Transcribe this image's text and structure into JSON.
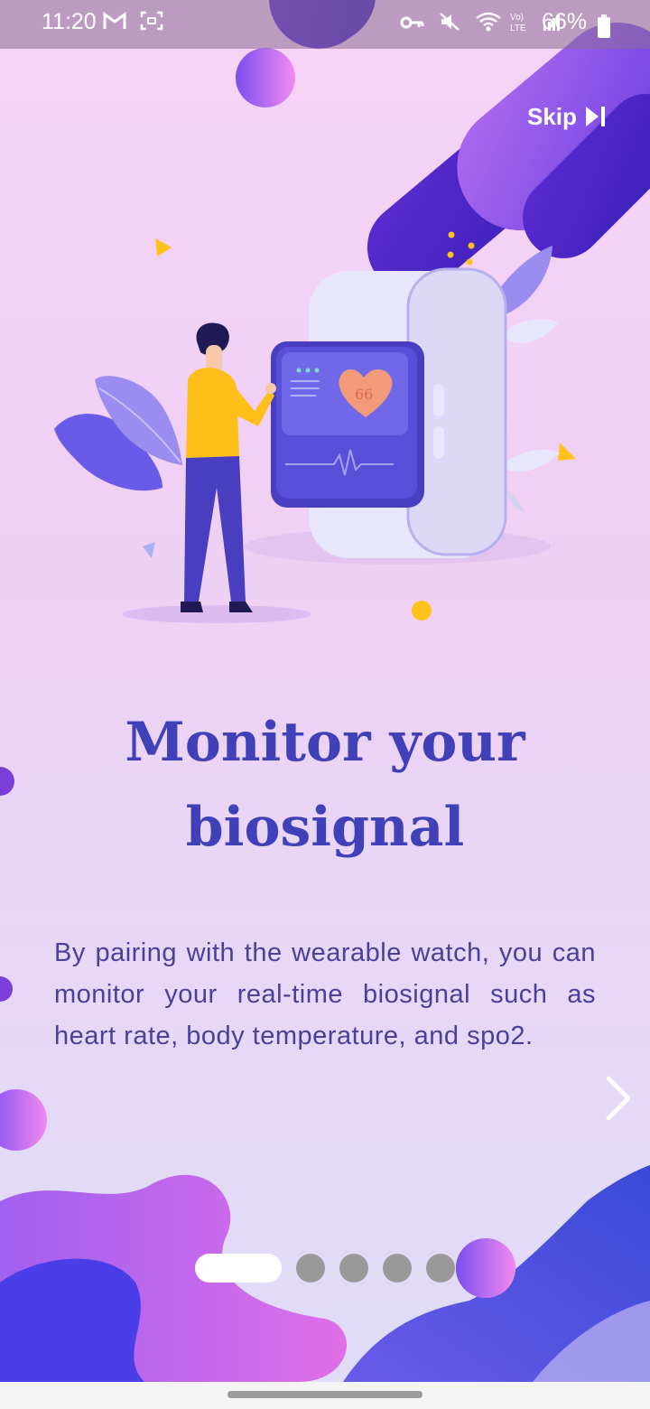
{
  "status_bar": {
    "time": "11:20",
    "battery_text": "66%",
    "left_icons": [
      "gmail-icon",
      "screenshot-icon"
    ],
    "right_icons": [
      "vpn-key-icon",
      "mute-icon",
      "wifi-icon",
      "volte-icon",
      "signal-icon",
      "battery-icon"
    ],
    "volte_label": "Vo) LTE"
  },
  "header": {
    "skip_label": "Skip"
  },
  "illustration": {
    "screen_number": "66"
  },
  "main": {
    "title": "Monitor your biosignal",
    "description": "By pairing with the wearable watch, you can monitor your real-time biosignal such as heart rate, body temperature, and spo2."
  },
  "pager": {
    "current_page": 1,
    "total_pages": 5
  },
  "colors": {
    "title": "#4040b8",
    "description": "#4a3f9a",
    "accent_purple": "#6a3ee0",
    "accent_pink": "#f07ee8"
  }
}
